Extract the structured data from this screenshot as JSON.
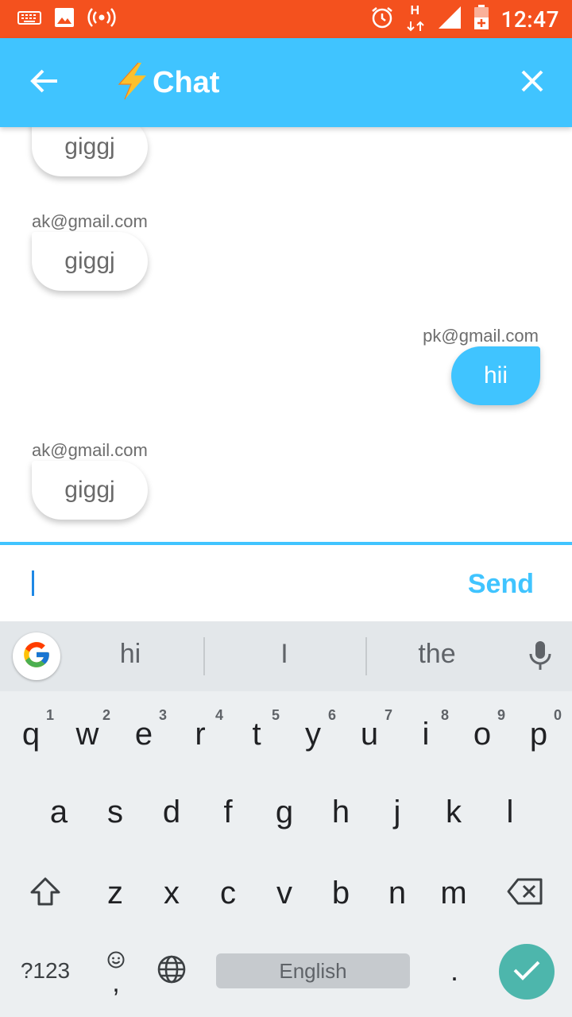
{
  "status_bar": {
    "time": "12:47",
    "network_type": "H",
    "icons": [
      "keyboard-icon",
      "image-icon",
      "hotspot-icon",
      "alarm-icon",
      "data-arrows-icon",
      "signal-icon",
      "battery-charging-icon"
    ]
  },
  "app_bar": {
    "title": "Chat",
    "title_icon": "lightning-bolt-icon",
    "back_icon": "back-arrow-icon",
    "close_icon": "close-icon",
    "color": "#40C4FF"
  },
  "messages": [
    {
      "sender": "",
      "text": "giggj",
      "direction": "incoming"
    },
    {
      "sender": "ak@gmail.com",
      "text": "giggj",
      "direction": "incoming"
    },
    {
      "sender": "pk@gmail.com",
      "text": "hii",
      "direction": "outgoing"
    },
    {
      "sender": "ak@gmail.com",
      "text": "giggj",
      "direction": "incoming"
    }
  ],
  "composer": {
    "value": "",
    "placeholder": "",
    "send_label": "Send"
  },
  "keyboard": {
    "suggestions": [
      "hi",
      "I",
      "the"
    ],
    "row1": [
      "q",
      "w",
      "e",
      "r",
      "t",
      "y",
      "u",
      "i",
      "o",
      "p"
    ],
    "row1_hints": [
      "1",
      "2",
      "3",
      "4",
      "5",
      "6",
      "7",
      "8",
      "9",
      "0"
    ],
    "row2": [
      "a",
      "s",
      "d",
      "f",
      "g",
      "h",
      "j",
      "k",
      "l"
    ],
    "row3": [
      "z",
      "x",
      "c",
      "v",
      "b",
      "n",
      "m"
    ],
    "symbols_label": "?123",
    "comma": ",",
    "space_label": "English",
    "period": ".",
    "enter_color": "#4DB6AC"
  }
}
